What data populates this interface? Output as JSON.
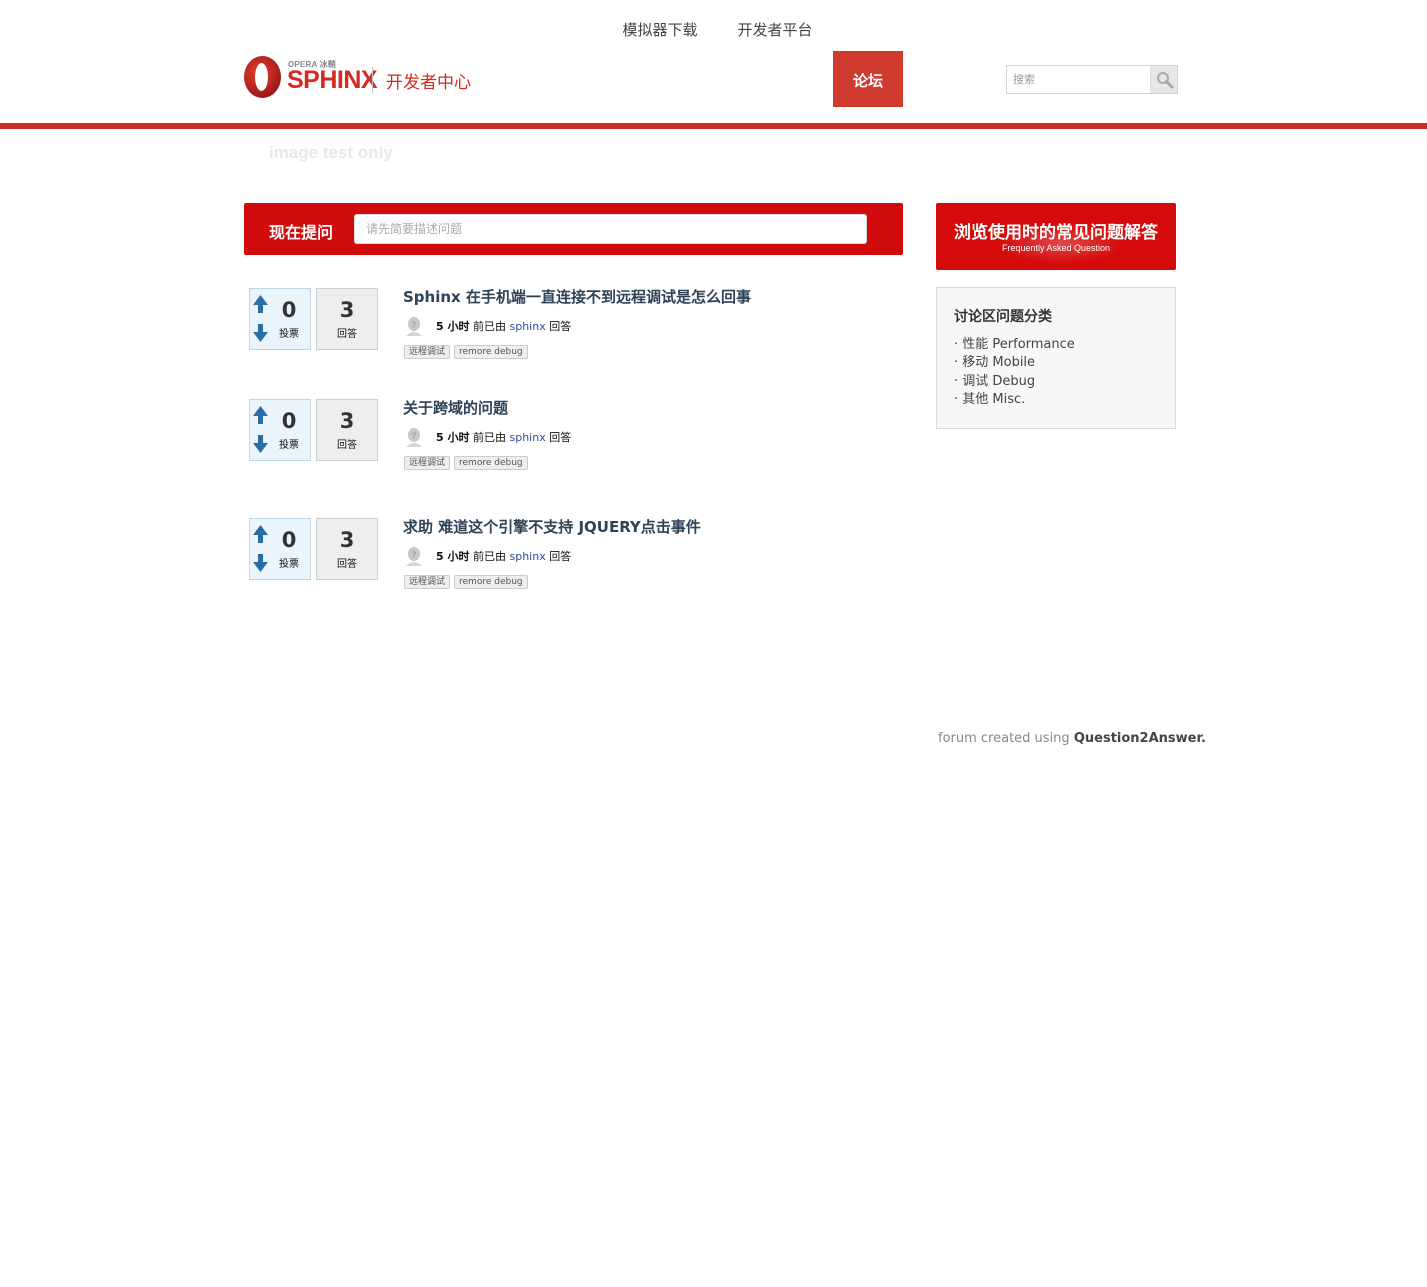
{
  "brand": {
    "opera_text": "OPERA 冰鞘",
    "name": "SPHINX",
    "subtitle": "开发者中心"
  },
  "nav": {
    "items": [
      {
        "label": "模拟器下载",
        "active": false
      },
      {
        "label": "开发者平台",
        "active": false
      },
      {
        "label": "论坛",
        "active": true
      }
    ]
  },
  "search": {
    "placeholder": "搜索",
    "button_icon": "magnifier-icon"
  },
  "banner": {
    "text": "image test only"
  },
  "ask": {
    "label": "现在提问",
    "placeholder": "请先简要描述问题"
  },
  "questions": [
    {
      "title": "Sphinx 在手机端一直连接不到远程调试是怎么回事",
      "votes": "0",
      "votes_label": "投票",
      "answers": "3",
      "answers_label": "回答",
      "when": "5 小时",
      "meta_prefix": "前已由",
      "user": "sphinx",
      "meta_suffix": "回答",
      "tags": [
        "远程调试",
        "remore debug"
      ]
    },
    {
      "title": "关于跨域的问题",
      "votes": "0",
      "votes_label": "投票",
      "answers": "3",
      "answers_label": "回答",
      "when": "5 小时",
      "meta_prefix": "前已由",
      "user": "sphinx",
      "meta_suffix": "回答",
      "tags": [
        "远程调试",
        "remore debug"
      ]
    },
    {
      "title": "求助 难道这个引擎不支持 JQUERY点击事件",
      "votes": "0",
      "votes_label": "投票",
      "answers": "3",
      "answers_label": "回答",
      "when": "5 小时",
      "meta_prefix": "前已由",
      "user": "sphinx",
      "meta_suffix": "回答",
      "tags": [
        "远程调试",
        "remore debug"
      ]
    }
  ],
  "sidebar": {
    "faq_title": "浏览使用时的常见问题解答",
    "faq_subtitle": "Frequently Asked Question",
    "categories_title": "讨论区问题分类",
    "categories": [
      "性能 Performance",
      "移动 Mobile",
      "调试 Debug",
      "其他 Misc."
    ]
  },
  "footer": {
    "prefix": "forum created using",
    "link": "Question2Answer."
  },
  "colors": {
    "brand_red": "#d00b0b",
    "nav_active": "#cf3a2e",
    "header_bar": "#c9302c",
    "title_blue": "#2e4258",
    "user_link": "#2a4fa0",
    "vote_arrow": "#2a6ea6"
  }
}
